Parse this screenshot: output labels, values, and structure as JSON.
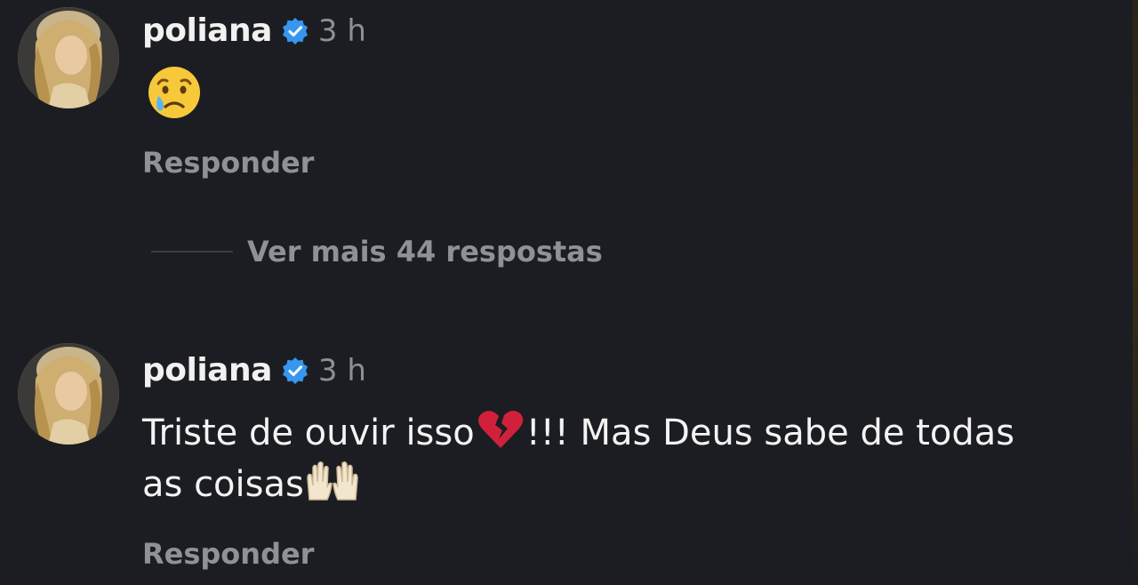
{
  "colors": {
    "background": "#1c1d22",
    "text_primary": "#f2f2f2",
    "text_secondary": "#8f9197",
    "verified_blue": "#3797f0",
    "broken_heart": "#d1213a"
  },
  "comments": [
    {
      "username": "poliana",
      "verified": true,
      "time": "3 h",
      "avatar": "profile-avatar",
      "content_emoji": "crying-face-emoji",
      "reply_label": "Responder"
    },
    {
      "username": "poliana",
      "verified": true,
      "time": "3 h",
      "avatar": "profile-avatar",
      "text_line1_a": "Triste de ouvir isso",
      "text_line1_b": "!!! Mas Deus sabe de todas",
      "text_line2": "as coisas",
      "inline_emojis": [
        "broken-heart-emoji",
        "raising-hands-emoji"
      ],
      "reply_label": "Responder"
    }
  ],
  "more_replies_label": "Ver mais 44 respostas"
}
